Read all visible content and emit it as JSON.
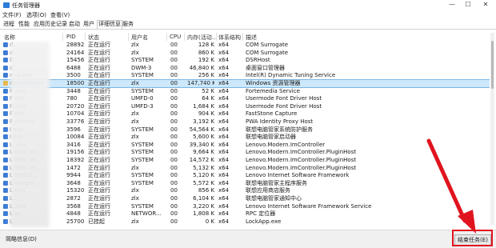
{
  "title": "任务管理器",
  "menu": [
    "文件(F)",
    "选项(O)",
    "查看(V)"
  ],
  "tabs": [
    "进程",
    "性能",
    "应用历史记录",
    "启动",
    "用户",
    "详细信息",
    "服务"
  ],
  "active_tab": "详细信息",
  "columns": [
    "名称",
    "PID",
    "状态",
    "用户名",
    "CPU",
    "内存(活动...",
    "体系结构",
    "描述"
  ],
  "rows": [
    {
      "name": "d",
      "pid": "28892",
      "status": "正在运行",
      "user": "zlx",
      "cpu": "00",
      "mem": "128 K",
      "arch": "x64",
      "desc": "COM Surrogate"
    },
    {
      "name": "d",
      "pid": "24164",
      "status": "正在运行",
      "user": "zlx",
      "cpu": "00",
      "mem": "860 K",
      "arch": "x64",
      "desc": "COM Surrogate"
    },
    {
      "name": "D",
      "pid": "15456",
      "status": "正在运行",
      "user": "SYSTEM",
      "cpu": "00",
      "mem": "192 K",
      "arch": "x64",
      "desc": "DSRHost"
    },
    {
      "name": "d",
      "pid": "6488",
      "status": "正在运行",
      "user": "DWM-3",
      "cpu": "00",
      "mem": "46,840 K",
      "arch": "x64",
      "desc": "桌面窗口管理器"
    },
    {
      "name": "e    ui.exe",
      "pid": "3500",
      "status": "正在运行",
      "user": "SYSTEM",
      "cpu": "00",
      "mem": "256 K",
      "arch": "x64",
      "desc": "Intel(R) Dynamic Tuning Service"
    },
    {
      "name": "explorer.exe",
      "pid": "18500",
      "status": "正在运行",
      "user": "zlx",
      "cpu": "00",
      "mem": "147,740 K",
      "arch": "x64",
      "desc": "Windows 资源管理器"
    },
    {
      "name": "F           .exe",
      "pid": "3448",
      "status": "正在运行",
      "user": "SYSTEM",
      "cpu": "00",
      "mem": "52 K",
      "arch": "x64",
      "desc": "Fortemedia Service"
    },
    {
      "name": "F           exe",
      "pid": "780",
      "status": "正在运行",
      "user": "UMFD-0",
      "cpu": "00",
      "mem": "64 K",
      "arch": "x64",
      "desc": "Usermode Font Driver Host"
    },
    {
      "name": "F           .exe",
      "pid": "20720",
      "status": "正在运行",
      "user": "UMFD-3",
      "cpu": "00",
      "mem": "1,684 K",
      "arch": "x64",
      "desc": "Usermode Font Driver Host"
    },
    {
      "name": "F           exe",
      "pid": "10704",
      "status": "正在运行",
      "user": "zlx",
      "cpu": "00",
      "mem": "904 K",
      "arch": "x64",
      "desc": "FastStone Capture"
    },
    {
      "name": "F          ser.exe",
      "pid": "33776",
      "status": "正在运行",
      "user": "zlx",
      "cpu": "00",
      "mem": "3,192 K",
      "arch": "x64",
      "desc": "PWA Identity Proxy Host"
    },
    {
      "name": "I           exe",
      "pid": "3596",
      "status": "正在运行",
      "user": "SYSTEM",
      "cpu": "00",
      "mem": "54,564 K",
      "arch": "x64",
      "desc": "联想电脑管家系统防护服务"
    },
    {
      "name": "I           exe",
      "pid": "10084",
      "status": "正在运行",
      "user": "zlx",
      "cpu": "00",
      "mem": "5,600 K",
      "arch": "x64",
      "desc": "联想电脑管家启动器"
    },
    {
      "name": "L           .exe",
      "pid": "3416",
      "status": "正在运行",
      "user": "SYSTEM",
      "cpu": "00",
      "mem": "39,340 K",
      "arch": "x64",
      "desc": "Lenovo.Modern.ImController"
    },
    {
      "name": "L     dern.Im...",
      "pid": "19156",
      "status": "正在运行",
      "user": "SYSTEM",
      "cpu": "00",
      "mem": "9,664 K",
      "arch": "x64",
      "desc": "Lenovo.Modern.ImController.PluginHost"
    },
    {
      "name": "L     dern.Im...",
      "pid": "18392",
      "status": "正在运行",
      "user": "SYSTEM",
      "cpu": "00",
      "mem": "14,572 K",
      "arch": "x64",
      "desc": "Lenovo.Modern.ImController.PluginHost"
    },
    {
      "name": "L     dern.Im...",
      "pid": "1472",
      "status": "正在运行",
      "user": "zlx",
      "cpu": "00",
      "mem": "5,132 K",
      "arch": "x64",
      "desc": "Lenovo.Modern.ImController.PluginHost"
    },
    {
      "name": "L     netSof...",
      "pid": "9944",
      "status": "正在运行",
      "user": "SYSTEM",
      "cpu": "00",
      "mem": "5,120 K",
      "arch": "x64",
      "desc": "Lenovo Internet Software Framework"
    },
    {
      "name": "L     anager...",
      "pid": "3648",
      "status": "正在运行",
      "user": "SYSTEM",
      "cpu": "00",
      "mem": "5,572 K",
      "arch": "x64",
      "desc": "联想电脑管家主程序服务"
    },
    {
      "name": "L     eAS...",
      "pid": "15320",
      "status": "正在运行",
      "user": "zlx",
      "cpu": "00",
      "mem": "856 K",
      "arch": "x64",
      "desc": "联想应用商店服务"
    },
    {
      "name": "L     ...",
      "pid": "2872",
      "status": "正在运行",
      "user": "zlx",
      "cpu": "00",
      "mem": "6,104 K",
      "arch": "x64",
      "desc": "联想电脑管家通知中心"
    },
    {
      "name": "L     .exe",
      "pid": "3568",
      "status": "正在运行",
      "user": "SYSTEM",
      "cpu": "00",
      "mem": "3,220 K",
      "arch": "x64",
      "desc": "Lenovo Internet Software Framework Service"
    },
    {
      "name": "L     xe",
      "pid": "4848",
      "status": "正在运行",
      "user": "NETWOR...",
      "cpu": "00",
      "mem": "1,808 K",
      "arch": "x64",
      "desc": "RPC 定位器"
    },
    {
      "name": "L     ",
      "pid": "25700",
      "status": "已挂起",
      "user": "zlx",
      "cpu": "00",
      "mem": "0 K",
      "arch": "x64",
      "desc": "LockApp.exe"
    }
  ],
  "footer": {
    "less_details": "简略信息(D)",
    "end_task": "结束任务(E)"
  }
}
